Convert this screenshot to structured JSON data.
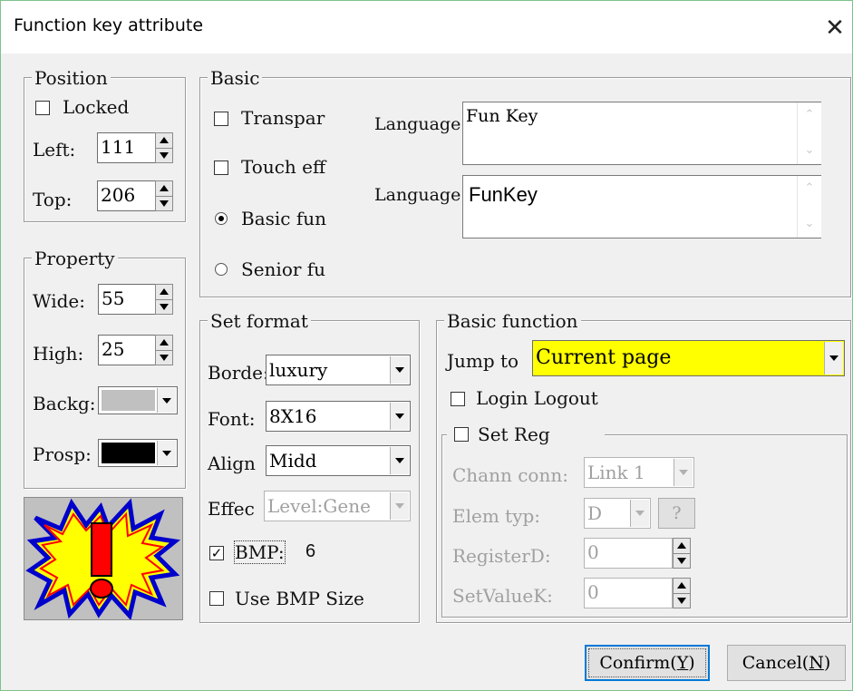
{
  "window": {
    "title": "Function key attribute",
    "close_glyph": "✕"
  },
  "position": {
    "title": "Position",
    "locked_label": "Locked",
    "left_label": "Left:",
    "left_value": "111",
    "top_label": "Top:",
    "top_value": "206"
  },
  "property": {
    "title": "Property",
    "wide_label": "Wide:",
    "wide_value": "55",
    "high_label": "High:",
    "high_value": "25",
    "backg_label": "Backg:",
    "backg_color": "#c0c0c0",
    "prosp_label": "Prosp:",
    "prosp_color": "#000000"
  },
  "basic": {
    "title": "Basic",
    "transparent_label": "Transpar",
    "touch_label": "Touch eff",
    "basic_fun_label": "Basic fun",
    "senior_label": "Senior fu",
    "language1_label": "Language",
    "language1_text": "Fun Key",
    "language2_label": "Language",
    "language2_text": "FunKey"
  },
  "set_format": {
    "title": "Set format",
    "border_label": "Borde:",
    "border_value": "luxury",
    "font_label": "Font:",
    "font_value": "8X16",
    "align_label": "Align",
    "align_value": "Midd",
    "effect_label": "Effec",
    "effect_value": "Level:Gene",
    "bmp_label": "BMP:",
    "bmp_number": "6",
    "use_bmp_label": "Use BMP Size"
  },
  "basic_function": {
    "title": "Basic function",
    "jump_label": "Jump to",
    "jump_value": "Current page",
    "jump_color": "#ffff00",
    "login_label": "Login Logout",
    "set_reg_label": "Set Reg",
    "chann_label": "Chann conn:",
    "chann_value": "Link 1",
    "elem_label": "Elem typ:",
    "elem_value": "D",
    "elem_help": "?",
    "register_label": "RegisterD:",
    "register_value": "0",
    "setvalue_label": "SetValueK:",
    "setvalue_value": "0"
  },
  "buttons": {
    "confirm_text": "Confirm(",
    "confirm_key": "Y",
    "cancel_text": "Cancel(",
    "cancel_key": "N",
    "close_paren": ")"
  }
}
